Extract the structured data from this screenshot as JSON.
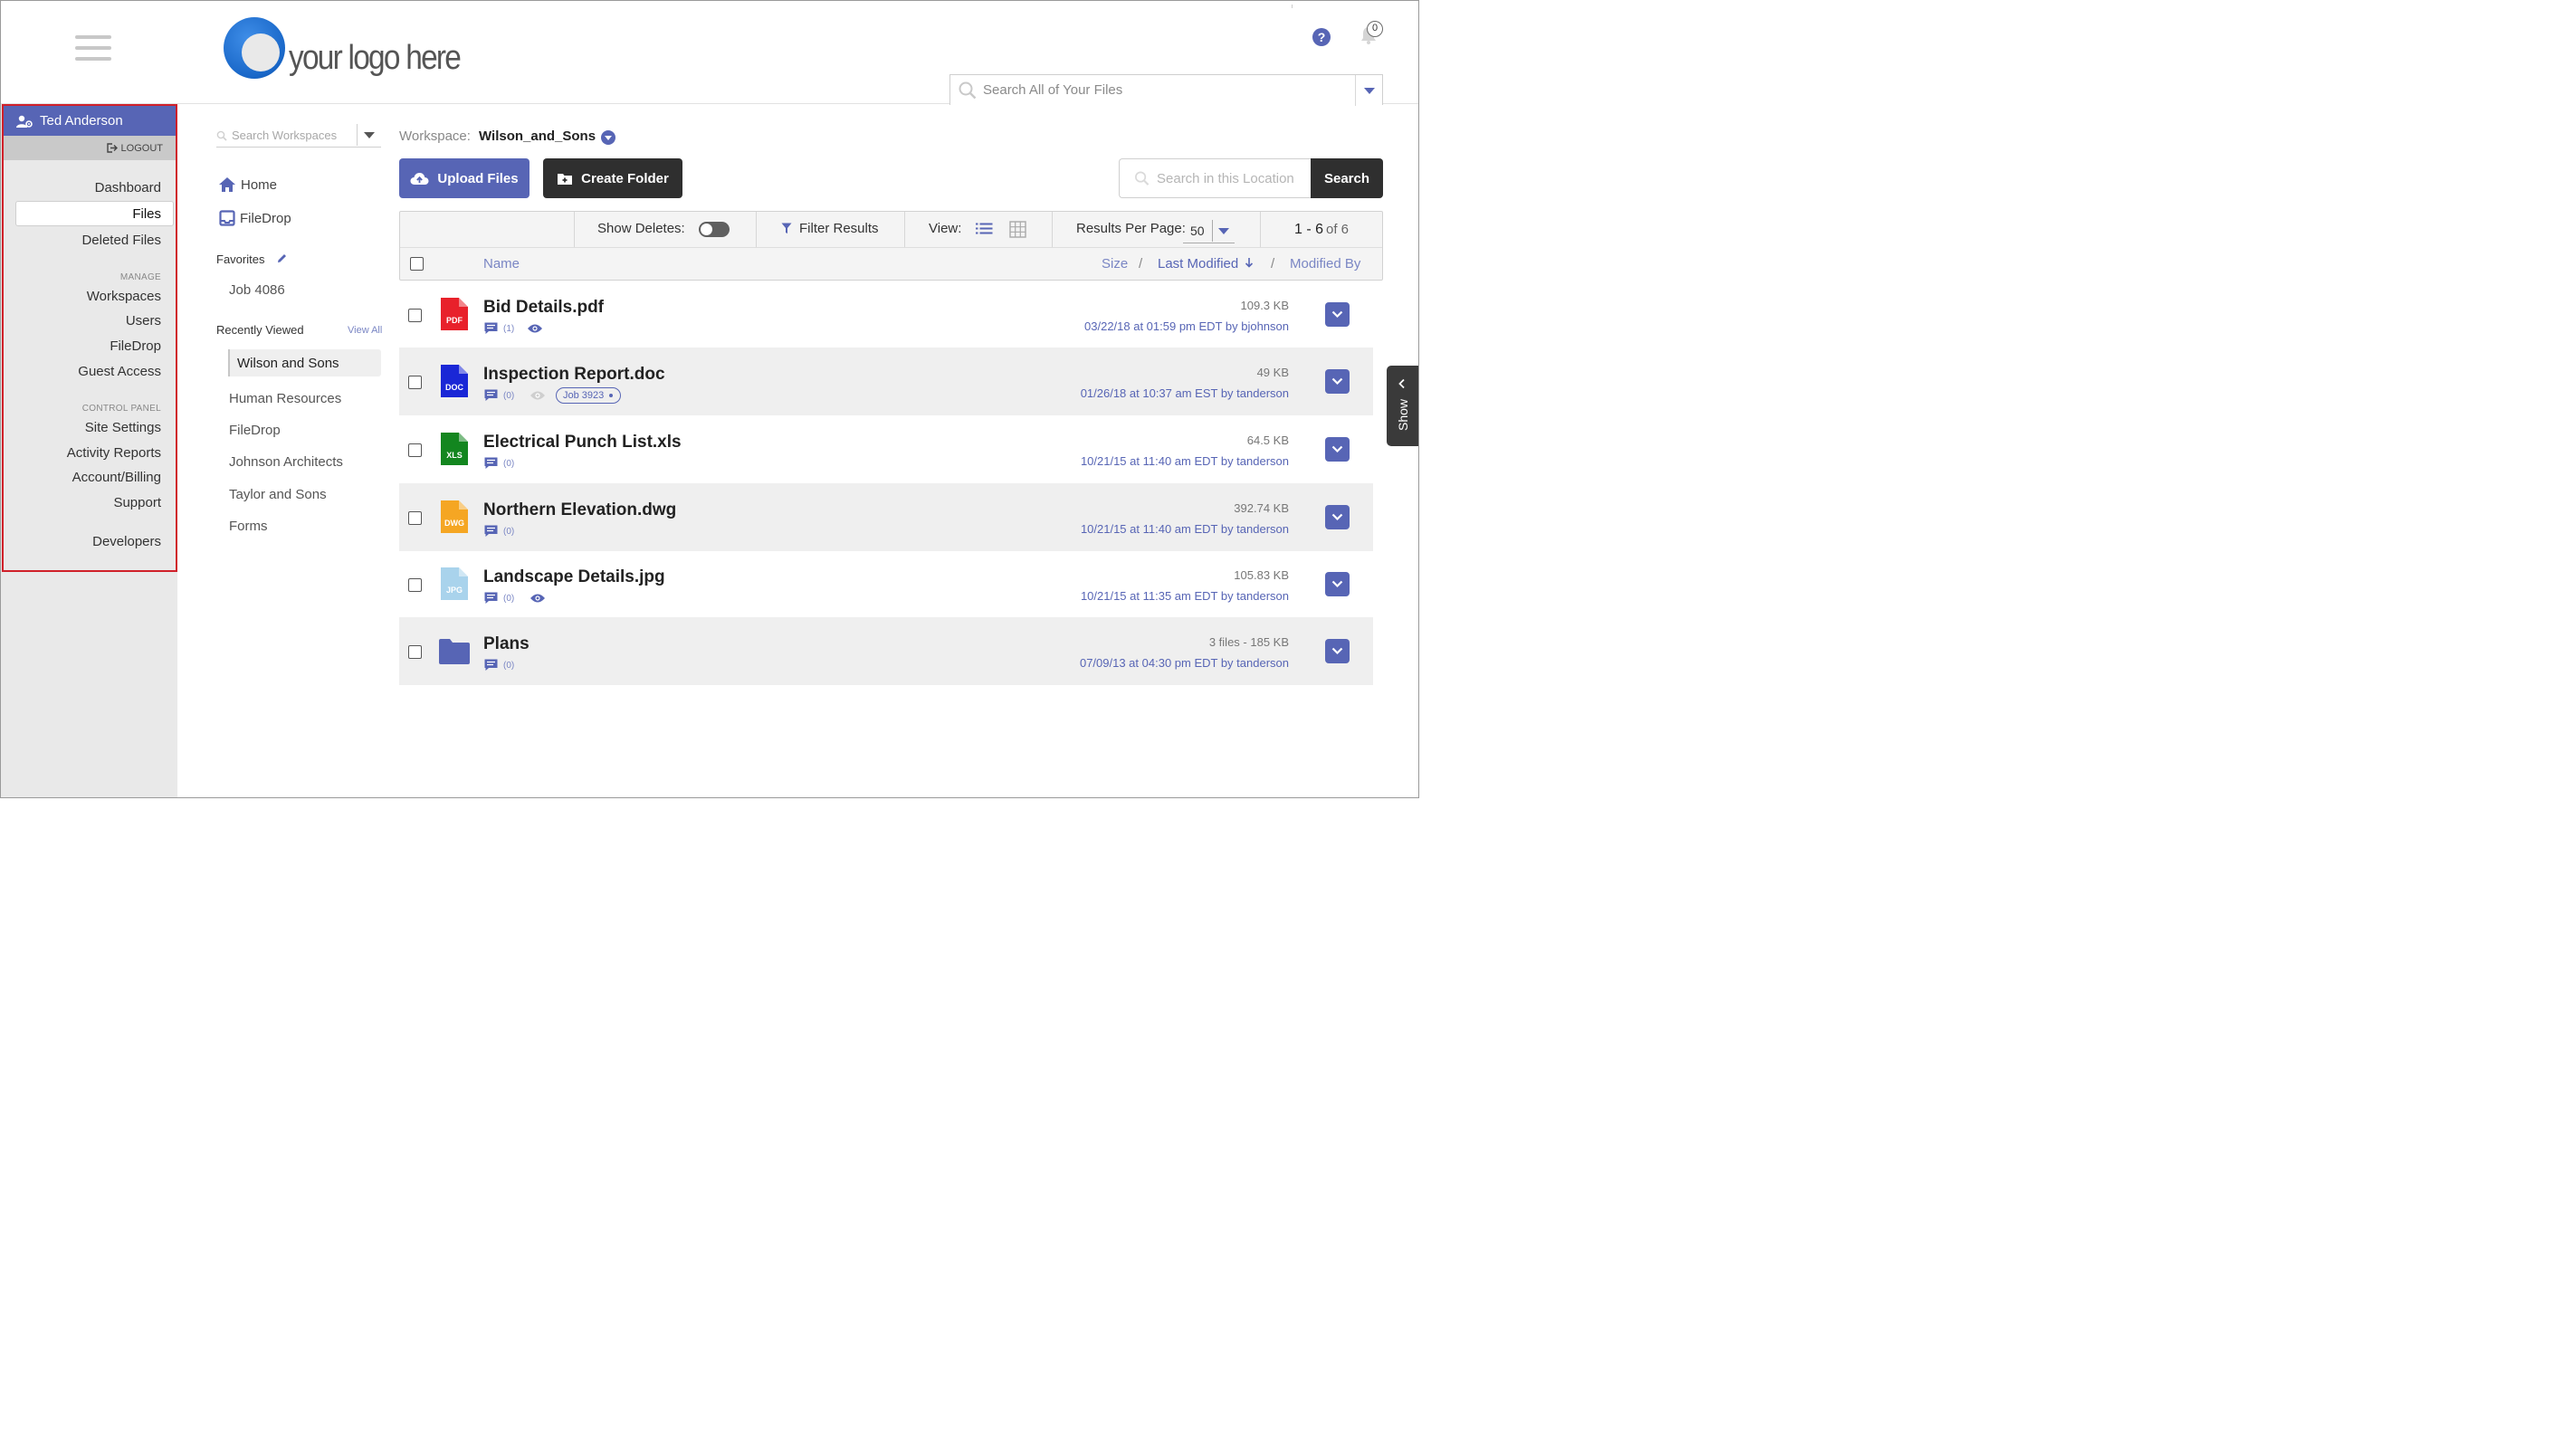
{
  "header": {
    "logo_text": "your logo here",
    "help_label": "?",
    "notifications_count": "0",
    "global_search_placeholder": "Search All of Your Files"
  },
  "user": {
    "name": "Ted Anderson",
    "logout_label": "LOGOUT"
  },
  "sidebar": {
    "items": [
      {
        "label": "Dashboard"
      },
      {
        "label": "Files",
        "active": true
      },
      {
        "label": "Deleted Files"
      }
    ],
    "manage_heading": "MANAGE",
    "manage_items": [
      {
        "label": "Workspaces"
      },
      {
        "label": "Users"
      },
      {
        "label": "FileDrop"
      },
      {
        "label": "Guest Access"
      }
    ],
    "control_heading": "CONTROL PANEL",
    "control_items": [
      {
        "label": "Site Settings"
      },
      {
        "label": "Activity Reports"
      },
      {
        "label": "Account/Billing"
      },
      {
        "label": "Support"
      }
    ],
    "developers_label": "Developers"
  },
  "workspaces": {
    "search_placeholder": "Search Workspaces",
    "home_label": "Home",
    "filedrop_label": "FileDrop",
    "favorites_heading": "Favorites",
    "favorites": [
      "Job 4086"
    ],
    "recent_heading": "Recently Viewed",
    "view_all_label": "View All",
    "recent": [
      "Wilson and Sons",
      "Human Resources",
      "FileDrop",
      "Johnson Architects",
      "Taylor and Sons",
      "Forms"
    ]
  },
  "workspace_bar": {
    "label": "Workspace:",
    "name": "Wilson_and_Sons"
  },
  "actions": {
    "upload_label": "Upload Files",
    "create_folder_label": "Create Folder",
    "location_search_placeholder": "Search in this Location",
    "search_button_label": "Search"
  },
  "toolbar": {
    "show_deletes_label": "Show Deletes:",
    "show_deletes_on": false,
    "filter_label": "Filter Results",
    "view_label": "View:",
    "rpp_label": "Results Per Page:",
    "rpp_value": "50",
    "range_label": "1 - 6",
    "of_label": "of 6"
  },
  "columns": {
    "name": "Name",
    "size": "Size",
    "last_modified": "Last Modified",
    "modified_by": "Modified By"
  },
  "files": [
    {
      "name": "Bid Details.pdf",
      "type": "PDF",
      "color": "#e8212b",
      "comments": "(1)",
      "viewed": true,
      "tag": "",
      "size": "109.3 KB",
      "modified": "03/22/18 at 01:59 pm EDT by bjohnson"
    },
    {
      "name": "Inspection Report.doc",
      "type": "DOC",
      "color": "#1a27d6",
      "comments": "(0)",
      "viewed": false,
      "tag": "Job 3923",
      "size": "49 KB",
      "modified": "01/26/18 at 10:37 am EST by tanderson"
    },
    {
      "name": "Electrical Punch List.xls",
      "type": "XLS",
      "color": "#13861f",
      "comments": "(0)",
      "viewed": null,
      "tag": "",
      "size": "64.5 KB",
      "modified": "10/21/15 at 11:40 am EDT by tanderson"
    },
    {
      "name": "Northern Elevation.dwg",
      "type": "DWG",
      "color": "#f5a623",
      "comments": "(0)",
      "viewed": null,
      "tag": "",
      "size": "392.74 KB",
      "modified": "10/21/15 at 11:40 am EDT by tanderson"
    },
    {
      "name": "Landscape Details.jpg",
      "type": "JPG",
      "color": "#a9d3ec",
      "comments": "(0)",
      "viewed": true,
      "tag": "",
      "size": "105.83 KB",
      "modified": "10/21/15 at 11:35 am EDT by tanderson"
    },
    {
      "name": "Plans",
      "type": "folder",
      "color": "#5765b5",
      "comments": "(0)",
      "viewed": null,
      "tag": "",
      "size": "3 files - 185 KB",
      "modified": "07/09/13 at 04:30 pm EDT by tanderson"
    }
  ],
  "show_panel_label": "Show",
  "colors": {
    "accent": "#5765b5",
    "dark_button": "#2f2f2f",
    "highlight_border": "#d0202a",
    "link": "#7a86c4"
  }
}
